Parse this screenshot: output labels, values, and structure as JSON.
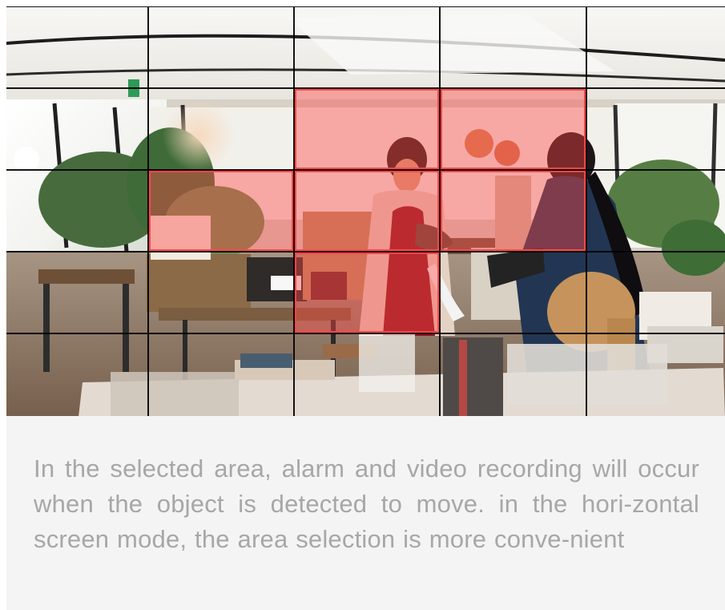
{
  "motion_detection": {
    "grid": {
      "columns": 5,
      "rows": 5,
      "selected_cells": [
        [
          1,
          2
        ],
        [
          1,
          3
        ],
        [
          2,
          1
        ],
        [
          2,
          2
        ],
        [
          2,
          3
        ],
        [
          3,
          2
        ]
      ],
      "selection_color": "#ff4646",
      "grid_line_color": "#000000"
    },
    "description": "In the selected area, alarm and video recording will occur when the object is detected to move. in the hori-zontal screen mode, the area selection is more conve-nient"
  },
  "colors": {
    "panel_background": "#f4f4f4",
    "text_gray": "#a7a7a7"
  }
}
